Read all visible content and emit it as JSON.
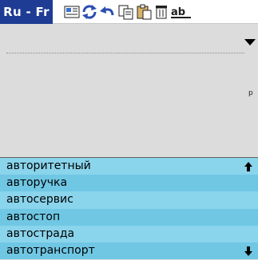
{
  "app": {
    "title": "Ru - Fr"
  },
  "toolbar": {
    "icons": [
      "dictionary-icon",
      "refresh-icon",
      "undo-icon",
      "copy-icon",
      "paste-icon",
      "trash-icon",
      "abc-icon"
    ],
    "abc_label": "ab"
  },
  "entry": {
    "value": "",
    "side_label": "p"
  },
  "list": {
    "items": [
      "авторитетный",
      "авторучка",
      "автосервис",
      "автостоп",
      "автострада",
      "автотранспорт"
    ]
  },
  "colors": {
    "title_bg": "#1f3c94",
    "row_light": "#8ad4ec",
    "row_dark": "#6fc7e4",
    "entry_bg": "#dcdcdc"
  }
}
